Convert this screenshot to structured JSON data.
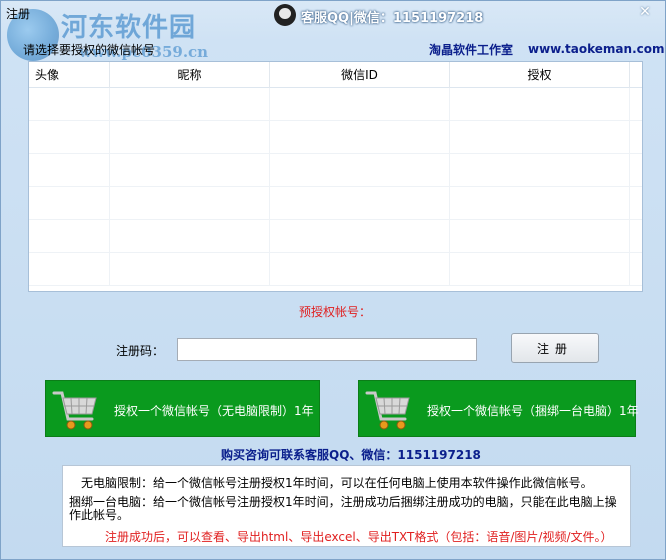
{
  "window": {
    "title": "注册"
  },
  "watermark": {
    "site_name": "河东软件园",
    "site_url": "www.pc0359.cn"
  },
  "header": {
    "support_text": "客服QQ|微信：1151197218",
    "prompt": "请选择要授权的微信帐号",
    "studio_name": "淘晶软件工作室",
    "studio_url": "www.taokeman.com"
  },
  "table": {
    "columns": [
      "头像",
      "昵称",
      "微信ID",
      "授权"
    ],
    "rows": []
  },
  "prereg": {
    "label": "预授权帐号："
  },
  "register": {
    "code_label": "注册码：",
    "code_value": "",
    "button_label": "注册"
  },
  "buy": {
    "option1": "授权一个微信帐号（无电脑限制）1年",
    "option2": "授权一个微信帐号（捆绑一台电脑）1年"
  },
  "contact": {
    "text": "购买咨询可联系客服QQ、微信：1151197218"
  },
  "info": {
    "line1": "无电脑限制：给一个微信帐号注册授权1年时间，可以在任何电脑上使用本软件操作此微信帐号。",
    "line2": "捆绑一台电脑：给一个微信帐号注册授权1年时间，注册成功后捆绑注册成功的电脑，只能在此电脑上操作此帐号。",
    "line3": "注册成功后，可以查看、导出html、导出excel、导出TXT格式（包括：语音/图片/视频/文件。）"
  },
  "colors": {
    "buy_button": "#0a9a1e",
    "notice_red": "#e02020",
    "link_blue": "#0b1f8c",
    "window_bg": "#c6ddf2"
  },
  "icons": {
    "support": "customer-service-icon",
    "close": "close-icon",
    "cart": "shopping-cart-icon",
    "logo": "site-logo-icon"
  }
}
